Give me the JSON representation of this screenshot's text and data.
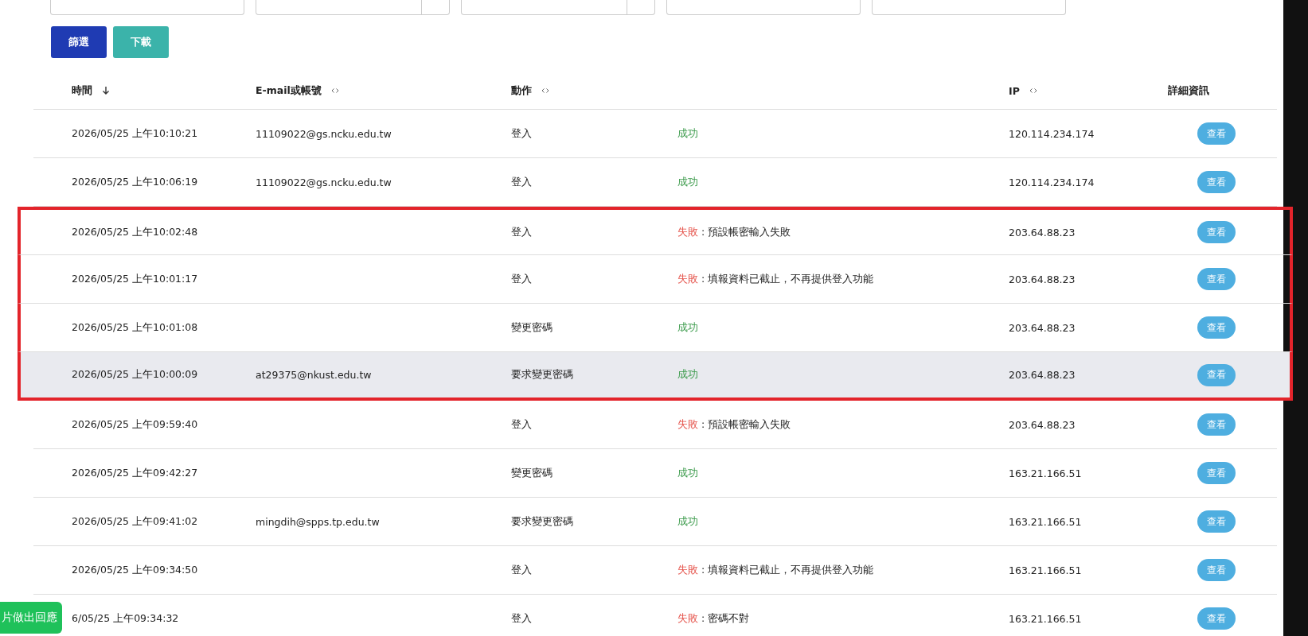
{
  "filter_fields": [
    {
      "kind": "text"
    },
    {
      "kind": "select"
    },
    {
      "kind": "select"
    },
    {
      "kind": "text"
    },
    {
      "kind": "text"
    }
  ],
  "buttons": [
    {
      "label": "篩選",
      "kind": "primary"
    },
    {
      "label": "下載",
      "kind": "secondary"
    }
  ],
  "table": {
    "columns": [
      {
        "label": "時間",
        "sortable": true,
        "sorted": true
      },
      {
        "label": "E-mail或帳號",
        "sortable": true,
        "sorted": false
      },
      {
        "label": "動作",
        "sortable": true,
        "sorted": false
      },
      {},
      {
        "label": "IP",
        "sortable": true,
        "sorted": false
      },
      {
        "label": "詳細資訊"
      }
    ],
    "rows": [
      {
        "time": "2026/05/25 上午10:10:21",
        "account": "11109022@gs.ncku.edu.tw",
        "action": "登入",
        "result": {
          "kind": "success",
          "status": "成功"
        },
        "ip": "120.114.234.174",
        "button": "查看",
        "highlighted": false,
        "hovered": false
      },
      {
        "time": "2026/05/25 上午10:06:19",
        "account": "11109022@gs.ncku.edu.tw",
        "action": "登入",
        "result": {
          "kind": "success",
          "status": "成功"
        },
        "ip": "120.114.234.174",
        "button": "查看",
        "highlighted": false,
        "hovered": false
      },
      {
        "time": "2026/05/25 上午10:02:48",
        "action": "登入",
        "result": {
          "kind": "fail",
          "status": "失敗",
          "detail": ": 預設帳密輸入失敗"
        },
        "ip": "203.64.88.23",
        "button": "查看",
        "highlighted": true,
        "hovered": false
      },
      {
        "time": "2026/05/25 上午10:01:17",
        "action": "登入",
        "result": {
          "kind": "fail",
          "status": "失敗",
          "detail": ": 填報資料已截止，不再提供登入功能"
        },
        "ip": "203.64.88.23",
        "button": "查看",
        "highlighted": true,
        "hovered": false
      },
      {
        "time": "2026/05/25 上午10:01:08",
        "action": "變更密碼",
        "result": {
          "kind": "success",
          "status": "成功"
        },
        "ip": "203.64.88.23",
        "button": "查看",
        "highlighted": true,
        "hovered": false
      },
      {
        "time": "2026/05/25 上午10:00:09",
        "account": "at29375@nkust.edu.tw",
        "action": "要求變更密碼",
        "result": {
          "kind": "success",
          "status": "成功"
        },
        "ip": "203.64.88.23",
        "button": "查看",
        "highlighted": true,
        "hovered": true
      },
      {
        "time": "2026/05/25 上午09:59:40",
        "action": "登入",
        "result": {
          "kind": "fail",
          "status": "失敗",
          "detail": ": 預設帳密輸入失敗"
        },
        "ip": "203.64.88.23",
        "button": "查看",
        "highlighted": false,
        "hovered": false
      },
      {
        "time": "2026/05/25 上午09:42:27",
        "action": "變更密碼",
        "result": {
          "kind": "success",
          "status": "成功"
        },
        "ip": "163.21.166.51",
        "button": "查看",
        "highlighted": false,
        "hovered": false
      },
      {
        "time": "2026/05/25 上午09:41:02",
        "account": "mingdih@spps.tp.edu.tw",
        "action": "要求變更密碼",
        "result": {
          "kind": "success",
          "status": "成功"
        },
        "ip": "163.21.166.51",
        "button": "查看",
        "highlighted": false,
        "hovered": false
      },
      {
        "time": "2026/05/25 上午09:34:50",
        "action": "登入",
        "result": {
          "kind": "fail",
          "status": "失敗",
          "detail": ": 填報資料已截止，不再提供登入功能"
        },
        "ip": "163.21.166.51",
        "button": "查看",
        "highlighted": false,
        "hovered": false
      },
      {
        "time": "6/05/25 上午09:34:32",
        "action": "登入",
        "result": {
          "kind": "fail",
          "status": "失敗",
          "detail": ": 密碼不對"
        },
        "ip": "163.21.166.51",
        "button": "查看",
        "highlighted": false,
        "hovered": false
      }
    ]
  },
  "floating_button": {
    "label": "片做出回應"
  }
}
